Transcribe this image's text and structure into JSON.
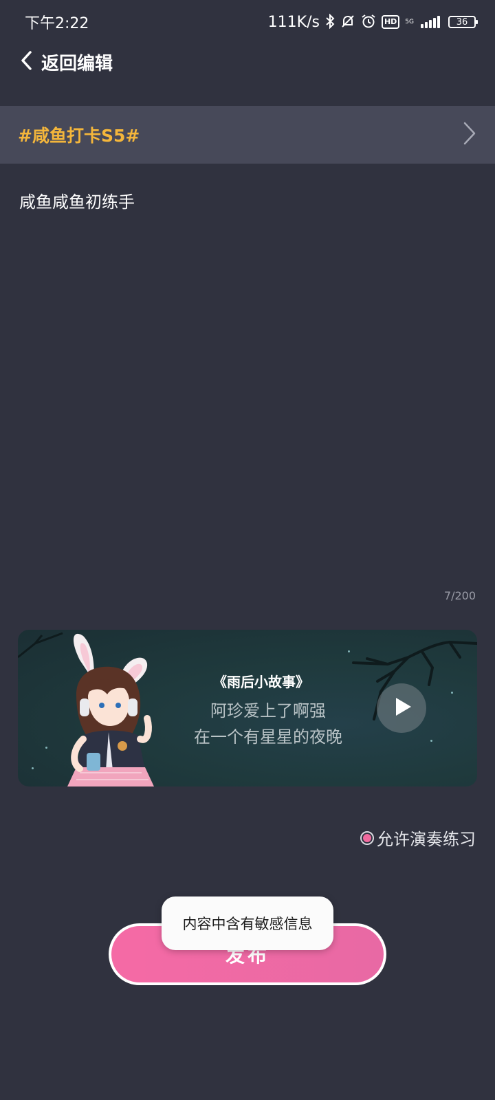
{
  "status_bar": {
    "time": "下午2:22",
    "net_speed": "111K/s",
    "network_type": "5G",
    "battery": "36",
    "icons": [
      "bluetooth-icon",
      "mute-icon",
      "alarm-icon",
      "hd-icon",
      "signal-icon",
      "battery-icon"
    ],
    "hd_label": "HD"
  },
  "header": {
    "back_label": "返回编辑"
  },
  "topic": {
    "label": "#咸鱼打卡S5#"
  },
  "post": {
    "text": "咸鱼咸鱼初练手",
    "char_count": "7/200"
  },
  "song_card": {
    "title": "《雨后小故事》",
    "line1": "阿珍爱上了啊强",
    "line2": "在一个有星星的夜晚"
  },
  "allow_practice": {
    "label": "允许演奏练习",
    "checked": true
  },
  "publish": {
    "label": "发布"
  },
  "toast": {
    "message": "内容中含有敏感信息"
  },
  "colors": {
    "background": "#30323f",
    "topic_bar": "#474959",
    "topic_text": "#f4b63b",
    "accent_pink": "#f06a9e"
  }
}
